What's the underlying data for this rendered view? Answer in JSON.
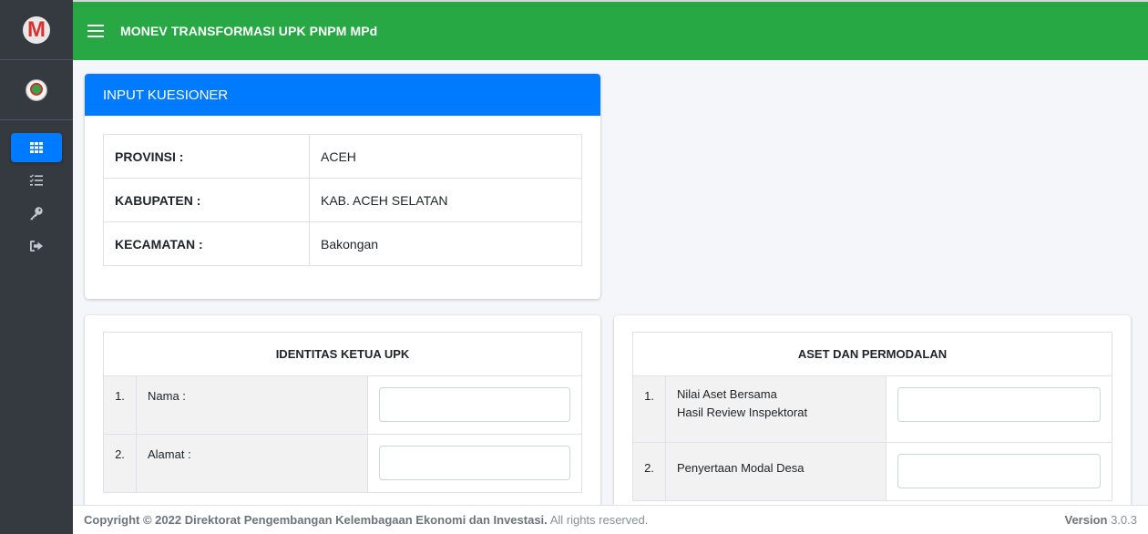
{
  "app": {
    "title": "MONEV TRANSFORMASI UPK PNPM MPd",
    "logo_letter": "M"
  },
  "sidebar": {
    "items": [
      {
        "name": "dashboard",
        "icon": "grid-icon",
        "active": true
      },
      {
        "name": "kuesioner",
        "icon": "checklist-icon",
        "active": false
      },
      {
        "name": "password",
        "icon": "key-icon",
        "active": false
      },
      {
        "name": "logout",
        "icon": "sign-out-icon",
        "active": false
      }
    ]
  },
  "colors": {
    "primary": "#007bff",
    "topbar": "#28a745",
    "sidebar": "#343a40"
  },
  "input_card": {
    "header": "INPUT KUESIONER",
    "rows": [
      {
        "label": "PROVINSI :",
        "value": "ACEH"
      },
      {
        "label": "KABUPATEN :",
        "value": "KAB. ACEH SELATAN"
      },
      {
        "label": "KECAMATAN :",
        "value": "Bakongan"
      }
    ]
  },
  "identitas": {
    "header": "IDENTITAS KETUA UPK",
    "rows": [
      {
        "num": "1.",
        "label": "Nama :",
        "value": ""
      },
      {
        "num": "2.",
        "label": "Alamat :",
        "value": ""
      }
    ]
  },
  "aset": {
    "header": "ASET DAN PERMODALAN",
    "rows": [
      {
        "num": "1.",
        "label_line1": "Nilai Aset Bersama",
        "label_line2": "Hasil Review Inspektorat",
        "value": ""
      },
      {
        "num": "2.",
        "label_line1": "Penyertaan Modal Desa",
        "label_line2": "",
        "value": ""
      }
    ]
  },
  "footer": {
    "copyright_bold": "Copyright © 2022 Direktorat Pengembangan Kelembagaan Ekonomi dan Investasi.",
    "copyright_rest": "All rights reserved.",
    "version_label": "Version",
    "version_number": "3.0.3"
  }
}
